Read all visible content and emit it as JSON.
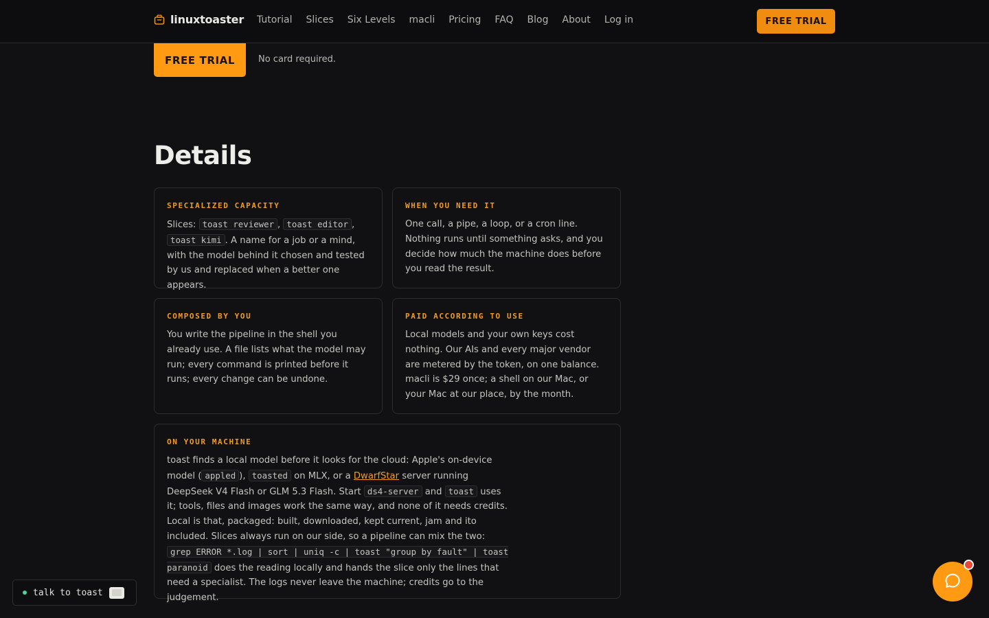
{
  "header": {
    "brand": "linuxtoaster",
    "nav": [
      "Tutorial",
      "Slices",
      "Six Levels",
      "macli",
      "Pricing",
      "FAQ",
      "Blog",
      "About",
      "Log in"
    ],
    "cta_label": "FREE TRIAL"
  },
  "hero": {
    "cta_label": "FREE TRIAL",
    "note": "No card required."
  },
  "details": {
    "title": "Details",
    "specialized": {
      "label": "SPECIALIZED CAPACITY",
      "prefix": "Slices:",
      "code1": "toast reviewer",
      "code2": "toast editor",
      "code3": "toast kimi",
      "rest": ". A name for a job or a mind, with the model behind it chosen and tested by us and replaced when a better one appears."
    },
    "when": {
      "label": "WHEN YOU NEED IT",
      "text": "One call, a pipe, a loop, or a cron line. Nothing runs until something asks, and you decide how much the machine does before you read the result."
    },
    "composed": {
      "label": "COMPOSED BY YOU",
      "text": "You write the pipeline in the shell you already use. A file lists what the model may run; every command is printed before it runs; every change can be undone."
    },
    "paid": {
      "label": "PAID ACCORDING TO USE",
      "text": "Local models and your own keys cost nothing. Our AIs and every major vendor are metered by the token, on one balance. macli is $29 once; a shell on our Mac, or your Mac at our place, by the month."
    },
    "machine": {
      "label": "ON YOUR MACHINE",
      "t1": "toast finds a local model before it looks for the cloud: Apple's on-device model (",
      "c1": "appled",
      "t2": "),",
      "c2": "toasted",
      "t3": "on MLX, or a",
      "link": "DwarfStar",
      "t4": "server running DeepSeek V4 Flash or GLM 5.3 Flash. Start",
      "c3": "ds4-server",
      "t5": "and",
      "c4": "toast",
      "t6": "uses it; tools, files and images work the same way, and none of it needs credits. Local is that, packaged: built, downloaded, kept current, jam and ito included. Slices always run on our side, so a pipeline can mix the two:",
      "c5": "grep ERROR *.log | sort | uniq -c | toast \"group by fault\" | toast paranoid",
      "t7": "does the reading locally and hands the slice only the lines that need a specialist. The logs never leave the machine; credits go to the judgement."
    }
  },
  "widgets": {
    "talk_label": "talk to toast"
  },
  "colors": {
    "accent": "#ff9a12",
    "background": "#111113",
    "badge": "#e5493a",
    "online": "#4fd39a"
  },
  "icons": [
    "toaster-icon",
    "chat-bubble-icon",
    "toast-icon"
  ]
}
